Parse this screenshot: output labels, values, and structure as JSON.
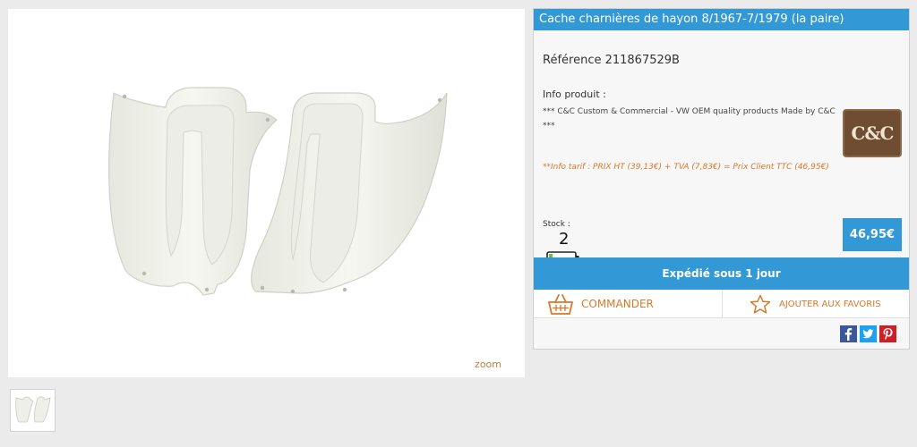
{
  "product": {
    "title": "Cache charnières de hayon 8/1967-7/1979 (la paire)",
    "reference": "Référence 211867529B",
    "info_label": "Info produit :",
    "description": "*** C&C Custom & Commercial - VW OEM quality products Made by C&C ***",
    "brand_logo_text": "C&C",
    "tarif_note": "**Info tarif : PRIX HT (39,13€) + TVA (7,83€) = Prix Client TTC (46,95€)",
    "stock_label": "Stock :",
    "stock_count": "2",
    "stock_level": 0.15,
    "price": "46,95€",
    "shipping": "Expédié sous 1 jour"
  },
  "gallery": {
    "zoom_label": "zoom"
  },
  "actions": {
    "order_label": "COMMANDER",
    "favorite_label": "AJOUTER AUX FAVORIS"
  },
  "share": {
    "facebook_icon": "facebook-icon",
    "twitter_icon": "twitter-icon",
    "pinterest_icon": "pinterest-icon"
  },
  "colors": {
    "accent_blue": "#3299d6",
    "accent_orange": "#d57a2a",
    "brand_brown": "#6e4d33"
  }
}
